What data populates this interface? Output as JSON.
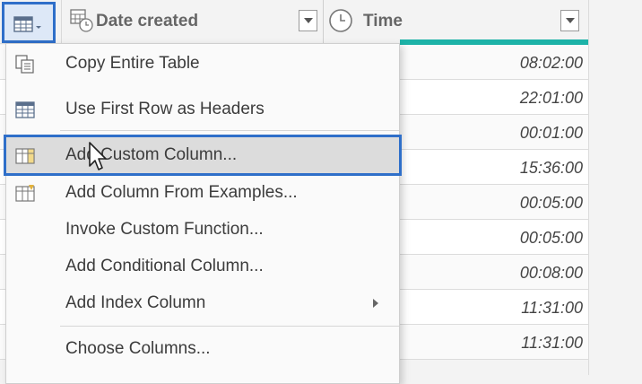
{
  "header": {
    "table_icon": "table-icon",
    "columns": [
      {
        "label": "Date created",
        "icon": "date-time-icon"
      },
      {
        "label": "Time",
        "icon": "clock-icon"
      }
    ],
    "accent_color": "#2f6fc9",
    "quality_color": "#1db3a8"
  },
  "rows": [
    {
      "time": "08:02:00"
    },
    {
      "time": "22:01:00"
    },
    {
      "time": "00:01:00"
    },
    {
      "time": "15:36:00"
    },
    {
      "time": "00:05:00"
    },
    {
      "time": "00:05:00"
    },
    {
      "time": "00:08:00"
    },
    {
      "time": "11:31:00"
    },
    {
      "time": "11:31:00"
    }
  ],
  "menu": {
    "items": [
      {
        "label": "Copy Entire Table",
        "icon": "copy-table-icon"
      },
      {
        "label": "Use First Row as Headers",
        "icon": "table-header-icon"
      },
      {
        "label": "Add Custom Column...",
        "icon": "custom-column-icon",
        "highlighted": true
      },
      {
        "label": "Add Column From Examples...",
        "icon": "column-examples-icon"
      },
      {
        "label": "Invoke Custom Function..."
      },
      {
        "label": "Add Conditional Column..."
      },
      {
        "label": "Add Index Column",
        "submenu": true
      },
      {
        "label": "Choose Columns..."
      }
    ]
  }
}
